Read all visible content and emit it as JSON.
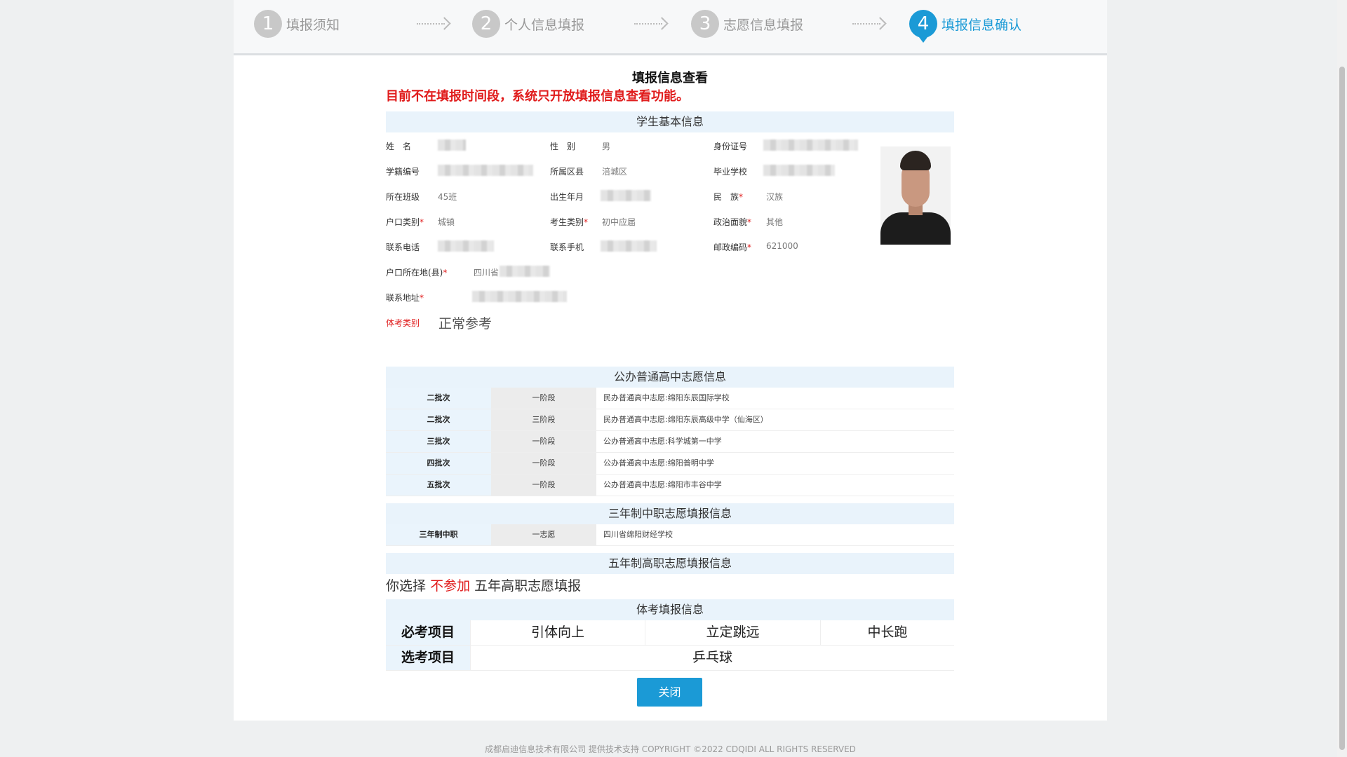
{
  "steps": [
    {
      "num": "1",
      "label": "填报须知"
    },
    {
      "num": "2",
      "label": "个人信息填报"
    },
    {
      "num": "3",
      "label": "志愿信息填报"
    },
    {
      "num": "4",
      "label": "填报信息确认"
    }
  ],
  "page": {
    "title": "填报信息查看",
    "notice": "目前不在填报时间段，系统只开放填报信息查看功能。"
  },
  "student": {
    "header": "学生基本信息",
    "name_label": "姓　名",
    "gender_label": "性　别",
    "gender": "男",
    "id_label": "身份证号",
    "xueji_label": "学籍编号",
    "district_label": "所属区县",
    "district": "涪城区",
    "school_label": "毕业学校",
    "class_label": "所在班级",
    "class": "45班",
    "birth_label": "出生年月",
    "ethnic_label": "民　族",
    "ethnic": "汉族",
    "hukou_type_label": "户口类别",
    "hukou_type": "城镇",
    "exam_type_label": "考生类别",
    "exam_type": "初中应届",
    "political_label": "政治面貌",
    "political": "其他",
    "phone_label": "联系电话",
    "mobile_label": "联系手机",
    "postcode_label": "邮政编码",
    "postcode": "621000",
    "hukou_loc_label": "户口所在地(县)",
    "hukou_loc": "四川省",
    "address_label": "联系地址",
    "pe_type_label": "体考类别",
    "pe_type": "正常参考",
    "required_mark": "*"
  },
  "public_hs": {
    "header": "公办普通高中志愿信息",
    "rows": [
      {
        "batch": "二批次",
        "stage": "一阶段",
        "school": "民办普通高中志愿:绵阳东辰国际学校"
      },
      {
        "batch": "二批次",
        "stage": "三阶段",
        "school": "民办普通高中志愿:绵阳东辰高级中学（仙海区）"
      },
      {
        "batch": "三批次",
        "stage": "一阶段",
        "school": "公办普通高中志愿:科学城第一中学"
      },
      {
        "batch": "四批次",
        "stage": "一阶段",
        "school": "公办普通高中志愿:绵阳普明中学"
      },
      {
        "batch": "五批次",
        "stage": "一阶段",
        "school": "公办普通高中志愿:绵阳市丰谷中学"
      }
    ]
  },
  "three_year": {
    "header": "三年制中职志愿填报信息",
    "rows": [
      {
        "batch": "三年制中职",
        "stage": "一志愿",
        "school": "四川省绵阳财经学校"
      }
    ]
  },
  "five_year": {
    "header": "五年制高职志愿填报信息",
    "prefix": "你选择",
    "choice": "不参加",
    "suffix": "五年高职志愿填报"
  },
  "pe_exam": {
    "header": "体考填报信息",
    "required_label": "必考项目",
    "required_items": [
      "引体向上",
      "立定跳远",
      "中长跑"
    ],
    "optional_label": "选考项目",
    "optional_item": "乒乓球"
  },
  "close_button": "关闭",
  "footer": "成都启迪信息技术有限公司 提供技术支持 COPYRIGHT ©2022 CDQIDI ALL RIGHTS RESERVED"
}
